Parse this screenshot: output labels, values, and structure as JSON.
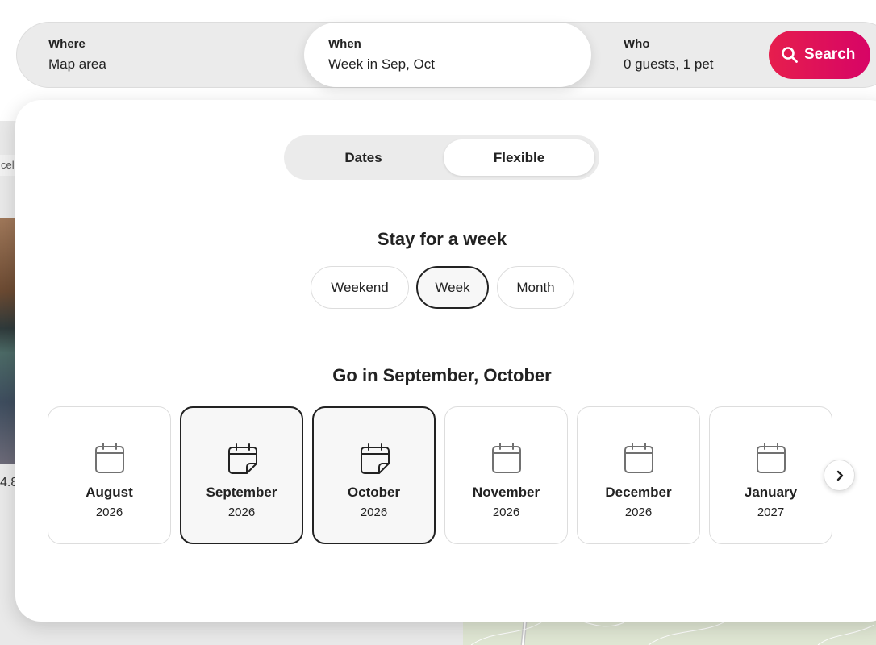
{
  "background": {
    "chip_text": "cel",
    "rating_text": "4.8"
  },
  "search": {
    "where_label": "Where",
    "where_value": "Map area",
    "when_label": "When",
    "when_value": "Week in Sep, Oct",
    "who_label": "Who",
    "who_value": "0 guests, 1 pet",
    "search_label": "Search"
  },
  "toggle": {
    "dates_label": "Dates",
    "flexible_label": "Flexible",
    "active": "Flexible"
  },
  "stay": {
    "title": "Stay for a week",
    "options": [
      "Weekend",
      "Week",
      "Month"
    ],
    "selected": "Week"
  },
  "go": {
    "title": "Go in September, October",
    "months": [
      {
        "name": "August",
        "year": "2026",
        "selected": false
      },
      {
        "name": "September",
        "year": "2026",
        "selected": true
      },
      {
        "name": "October",
        "year": "2026",
        "selected": true
      },
      {
        "name": "November",
        "year": "2026",
        "selected": false
      },
      {
        "name": "December",
        "year": "2026",
        "selected": false
      },
      {
        "name": "January",
        "year": "2027",
        "selected": false
      }
    ]
  },
  "colors": {
    "brand": "#e61e4d",
    "text": "#222222",
    "border": "#dddddd"
  }
}
